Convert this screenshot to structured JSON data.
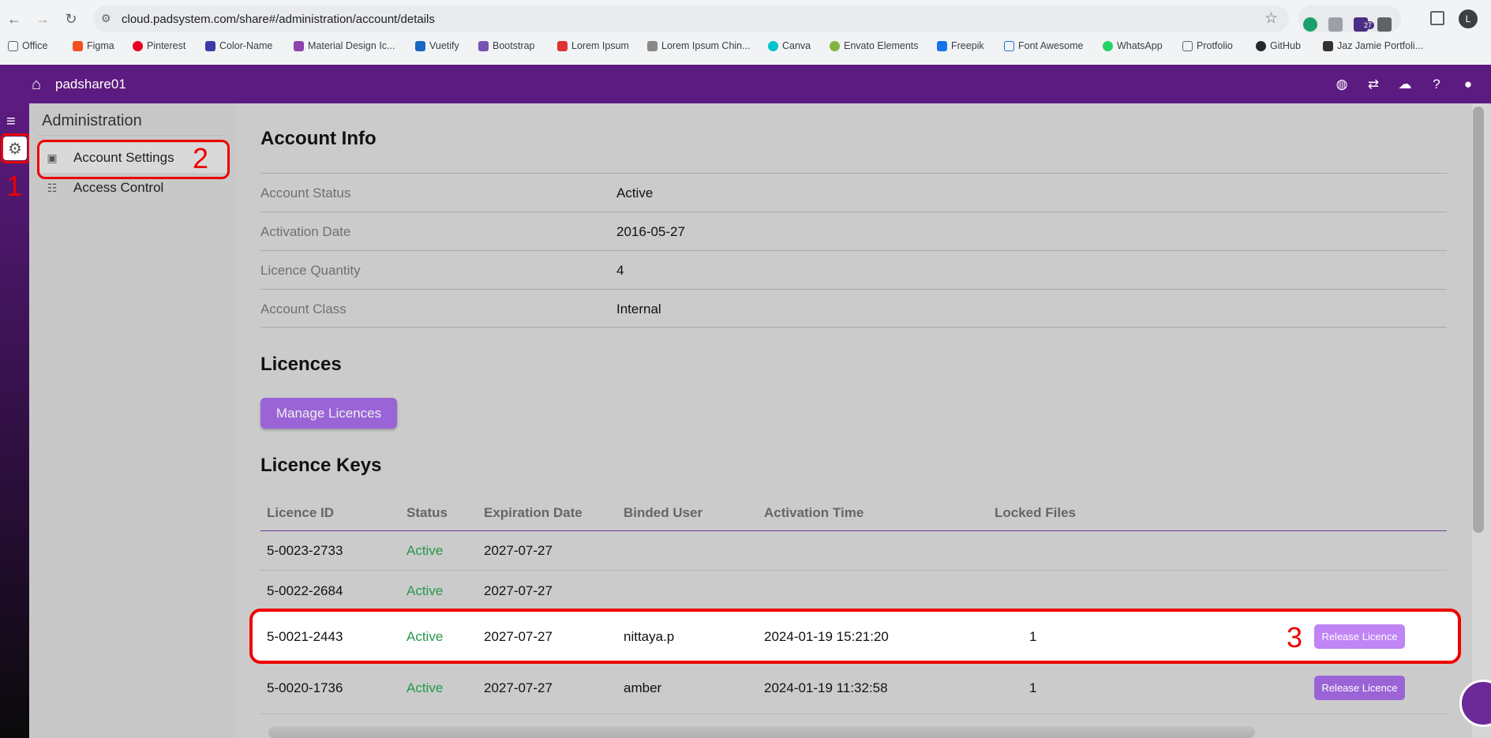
{
  "browser": {
    "url": "cloud.padsystem.com/share#/administration/account/details",
    "profile_initial": "L",
    "extension_badge": "27",
    "bookmarks": [
      "Office",
      "Figma",
      "Pinterest",
      "Color-Name",
      "Material Design Ic...",
      "Vuetify",
      "Bootstrap",
      "Lorem Ipsum",
      "Lorem Ipsum Chin...",
      "Canva",
      "Envato Elements",
      "Freepik",
      "Font Awesome",
      "WhatsApp",
      "Protfolio",
      "GitHub",
      "Jaz Jamie Portfoli..."
    ]
  },
  "appbar": {
    "title": "padshare01"
  },
  "sidebar": {
    "title": "Administration",
    "items": [
      {
        "label": "Account Settings",
        "icon": "wallet-icon"
      },
      {
        "label": "Access Control",
        "icon": "sliders-icon"
      }
    ]
  },
  "account_info": {
    "heading": "Account Info",
    "rows": [
      {
        "label": "Account Status",
        "value": "Active"
      },
      {
        "label": "Activation Date",
        "value": "2016-05-27"
      },
      {
        "label": "Licence Quantity",
        "value": "4"
      },
      {
        "label": "Account Class",
        "value": "Internal"
      }
    ]
  },
  "licences": {
    "heading": "Licences",
    "manage_button": "Manage Licences"
  },
  "licence_keys": {
    "heading": "Licence Keys",
    "columns": [
      "Licence ID",
      "Status",
      "Expiration Date",
      "Binded User",
      "Activation Time",
      "Locked Files"
    ],
    "rows": [
      {
        "id": "5-0023-2733",
        "status": "Active",
        "expiration": "2027-07-27",
        "user": "",
        "activation": "",
        "locked": "",
        "action": ""
      },
      {
        "id": "5-0022-2684",
        "status": "Active",
        "expiration": "2027-07-27",
        "user": "",
        "activation": "",
        "locked": "",
        "action": ""
      },
      {
        "id": "5-0021-2443",
        "status": "Active",
        "expiration": "2027-07-27",
        "user": "nittaya.p",
        "activation": "2024-01-19 15:21:20",
        "locked": "1",
        "action": "Release Licence"
      },
      {
        "id": "5-0020-1736",
        "status": "Active",
        "expiration": "2027-07-27",
        "user": "amber",
        "activation": "2024-01-19 11:32:58",
        "locked": "1",
        "action": "Release Licence"
      }
    ]
  },
  "annotations": [
    "1",
    "2",
    "3"
  ],
  "colors": {
    "appbar": "#5c1b80",
    "button": "#9a64d6",
    "release_active": "#c084f5",
    "release_dim": "#9a64d6",
    "status_active": "#24994a",
    "annotation": "#e00000"
  }
}
